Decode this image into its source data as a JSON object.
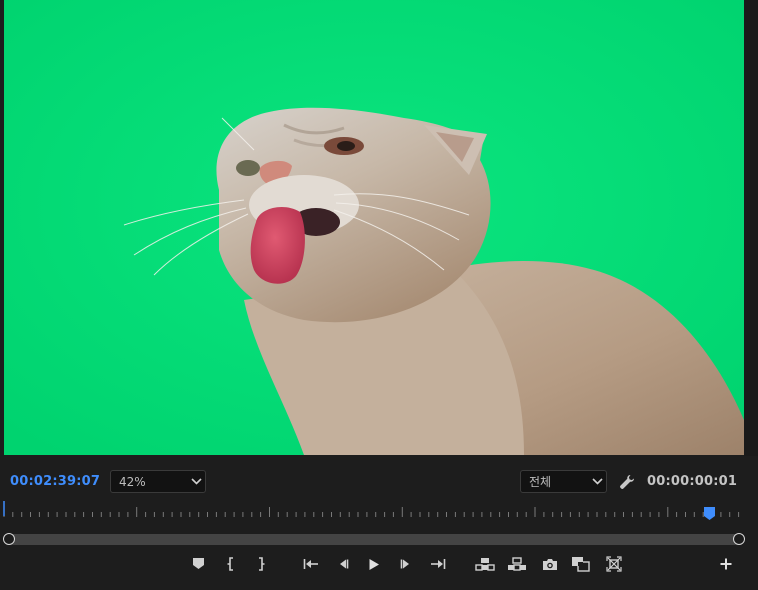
{
  "playback": {
    "current_timecode": "00:02:39:07",
    "duration_timecode": "00:00:00:01"
  },
  "zoom": {
    "selected": "42%"
  },
  "resolution": {
    "selected": "전체"
  },
  "colors": {
    "accent": "#3f8dfc",
    "green_screen": "#00dd77",
    "panel_bg": "#1d1d1d"
  },
  "icons": {
    "add_marker": "marker-icon",
    "mark_in": "mark-in-icon",
    "mark_out": "mark-out-icon",
    "go_to_in": "go-to-in-icon",
    "step_back": "step-back-icon",
    "play": "play-icon",
    "step_forward": "step-forward-icon",
    "go_to_out": "go-to-out-icon",
    "lift": "lift-icon",
    "extract": "extract-icon",
    "export_frame": "camera-icon",
    "comparison_view": "comparison-view-icon",
    "toggle_proxies": "proxy-icon",
    "button_editor": "plus-icon",
    "settings": "wrench-icon"
  }
}
